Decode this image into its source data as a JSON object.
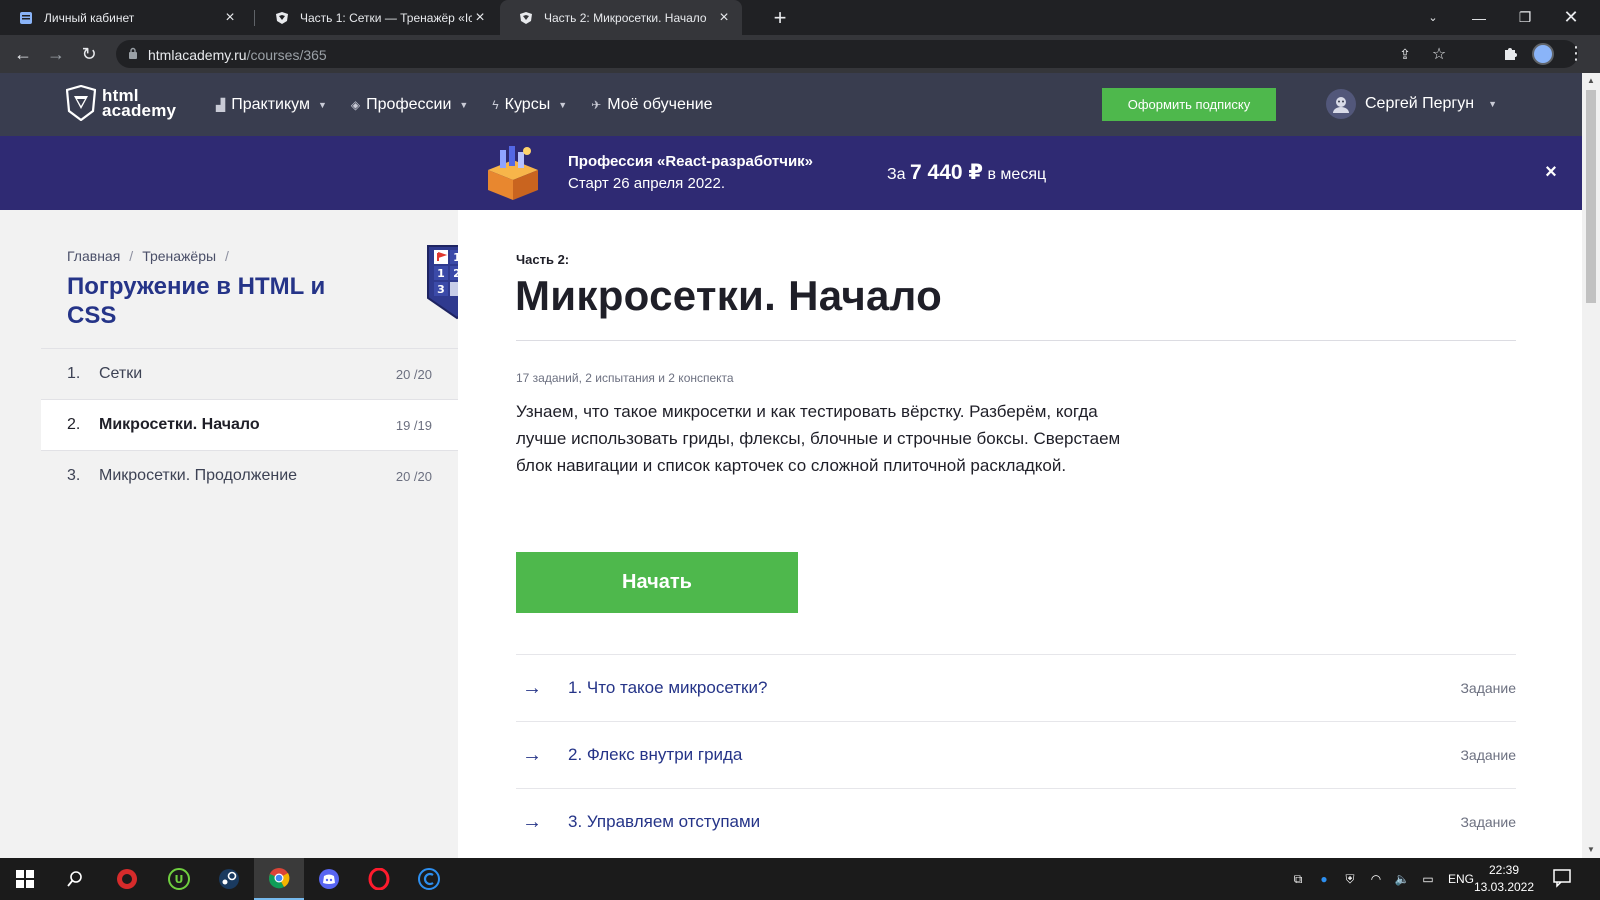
{
  "browser": {
    "tabs": [
      {
        "title": "Личный кабинет",
        "active": false
      },
      {
        "title": "Часть 1: Сетки — Тренажёр «Ic",
        "active": false
      },
      {
        "title": "Часть 2: Микросетки. Начало",
        "active": true
      }
    ],
    "new_tab_label": "+",
    "url_host": "htmlacademy.ru",
    "url_path": "/courses/365"
  },
  "header": {
    "logo_line1": "html",
    "logo_line2": "academy",
    "nav": [
      {
        "label": "Практикум"
      },
      {
        "label": "Профессии"
      },
      {
        "label": "Курсы"
      },
      {
        "label": "Моё обучение"
      }
    ],
    "subscribe_label": "Оформить подписку",
    "user_name": "Сергей Пергун"
  },
  "promo": {
    "title": "Профессия «React-разработчик»",
    "subtitle": "Старт 26 апреля 2022.",
    "price_prefix": "За",
    "price": "7 440 ₽",
    "price_suffix": "в месяц",
    "close": "×"
  },
  "sidebar": {
    "breadcrumb": [
      {
        "label": "Главная"
      },
      {
        "label": "Тренажёры"
      }
    ],
    "breadcrumb_sep": "/",
    "course_title": "Погружение в HTML и CSS",
    "chapters": [
      {
        "num": "1.",
        "name": "Сетки",
        "progress": "20 /20",
        "active": false
      },
      {
        "num": "2.",
        "name": "Микросетки. Начало",
        "progress": "19 /19",
        "active": true
      },
      {
        "num": "3.",
        "name": "Микросетки. Продолжение",
        "progress": "20 /20",
        "active": false
      }
    ]
  },
  "main": {
    "part_label": "Часть 2:",
    "title": "Микросетки. Начало",
    "summary": "17 заданий, 2 испытания и 2 конспекта",
    "description": "Узнаем, что такое микросетки и как тестировать вёрстку. Разберём, когда лучше использовать гриды, флексы, блочные и строчные боксы. Сверстаем блок навигации и список карточек со сложной плиточной раскладкой.",
    "start_label": "Начать",
    "tasks": [
      {
        "title": "1. Что такое микросетки?",
        "type": "Задание"
      },
      {
        "title": "2. Флекс внутри грида",
        "type": "Задание"
      },
      {
        "title": "3. Управляем отступами",
        "type": "Задание"
      }
    ]
  },
  "taskbar": {
    "lang": "ENG",
    "time": "22:39",
    "date": "13.03.2022"
  },
  "colors": {
    "accent_green": "#4eb84c",
    "header_bg": "#393d4f",
    "promo_bg": "#2f2a73",
    "title_blue": "#253488"
  },
  "icons": [
    "windows-start-icon",
    "search-icon",
    "chrome-icon",
    "discord-icon",
    "steam-icon",
    "opera-icon"
  ]
}
